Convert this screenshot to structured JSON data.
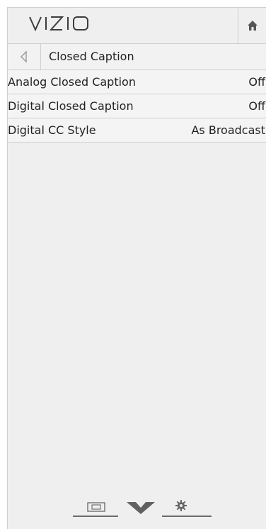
{
  "header": {
    "logo": "VIZIO",
    "home_icon": "home-icon"
  },
  "breadcrumb": {
    "back_icon": "back-arrow-icon",
    "title": "Closed Caption"
  },
  "menu": {
    "items": [
      {
        "label": "Analog Closed Caption",
        "value": "Off"
      },
      {
        "label": "Digital Closed Caption",
        "value": "Off"
      },
      {
        "label": "Digital CC Style",
        "value": "As Broadcast"
      }
    ]
  },
  "bottom_nav": {
    "icons": [
      "input-icon",
      "vizio-v-icon",
      "settings-gear-icon"
    ]
  },
  "colors": {
    "panel_bg": "#efefef",
    "border": "#cfcfcf",
    "text": "#222222",
    "icon": "#6a6a6a"
  }
}
